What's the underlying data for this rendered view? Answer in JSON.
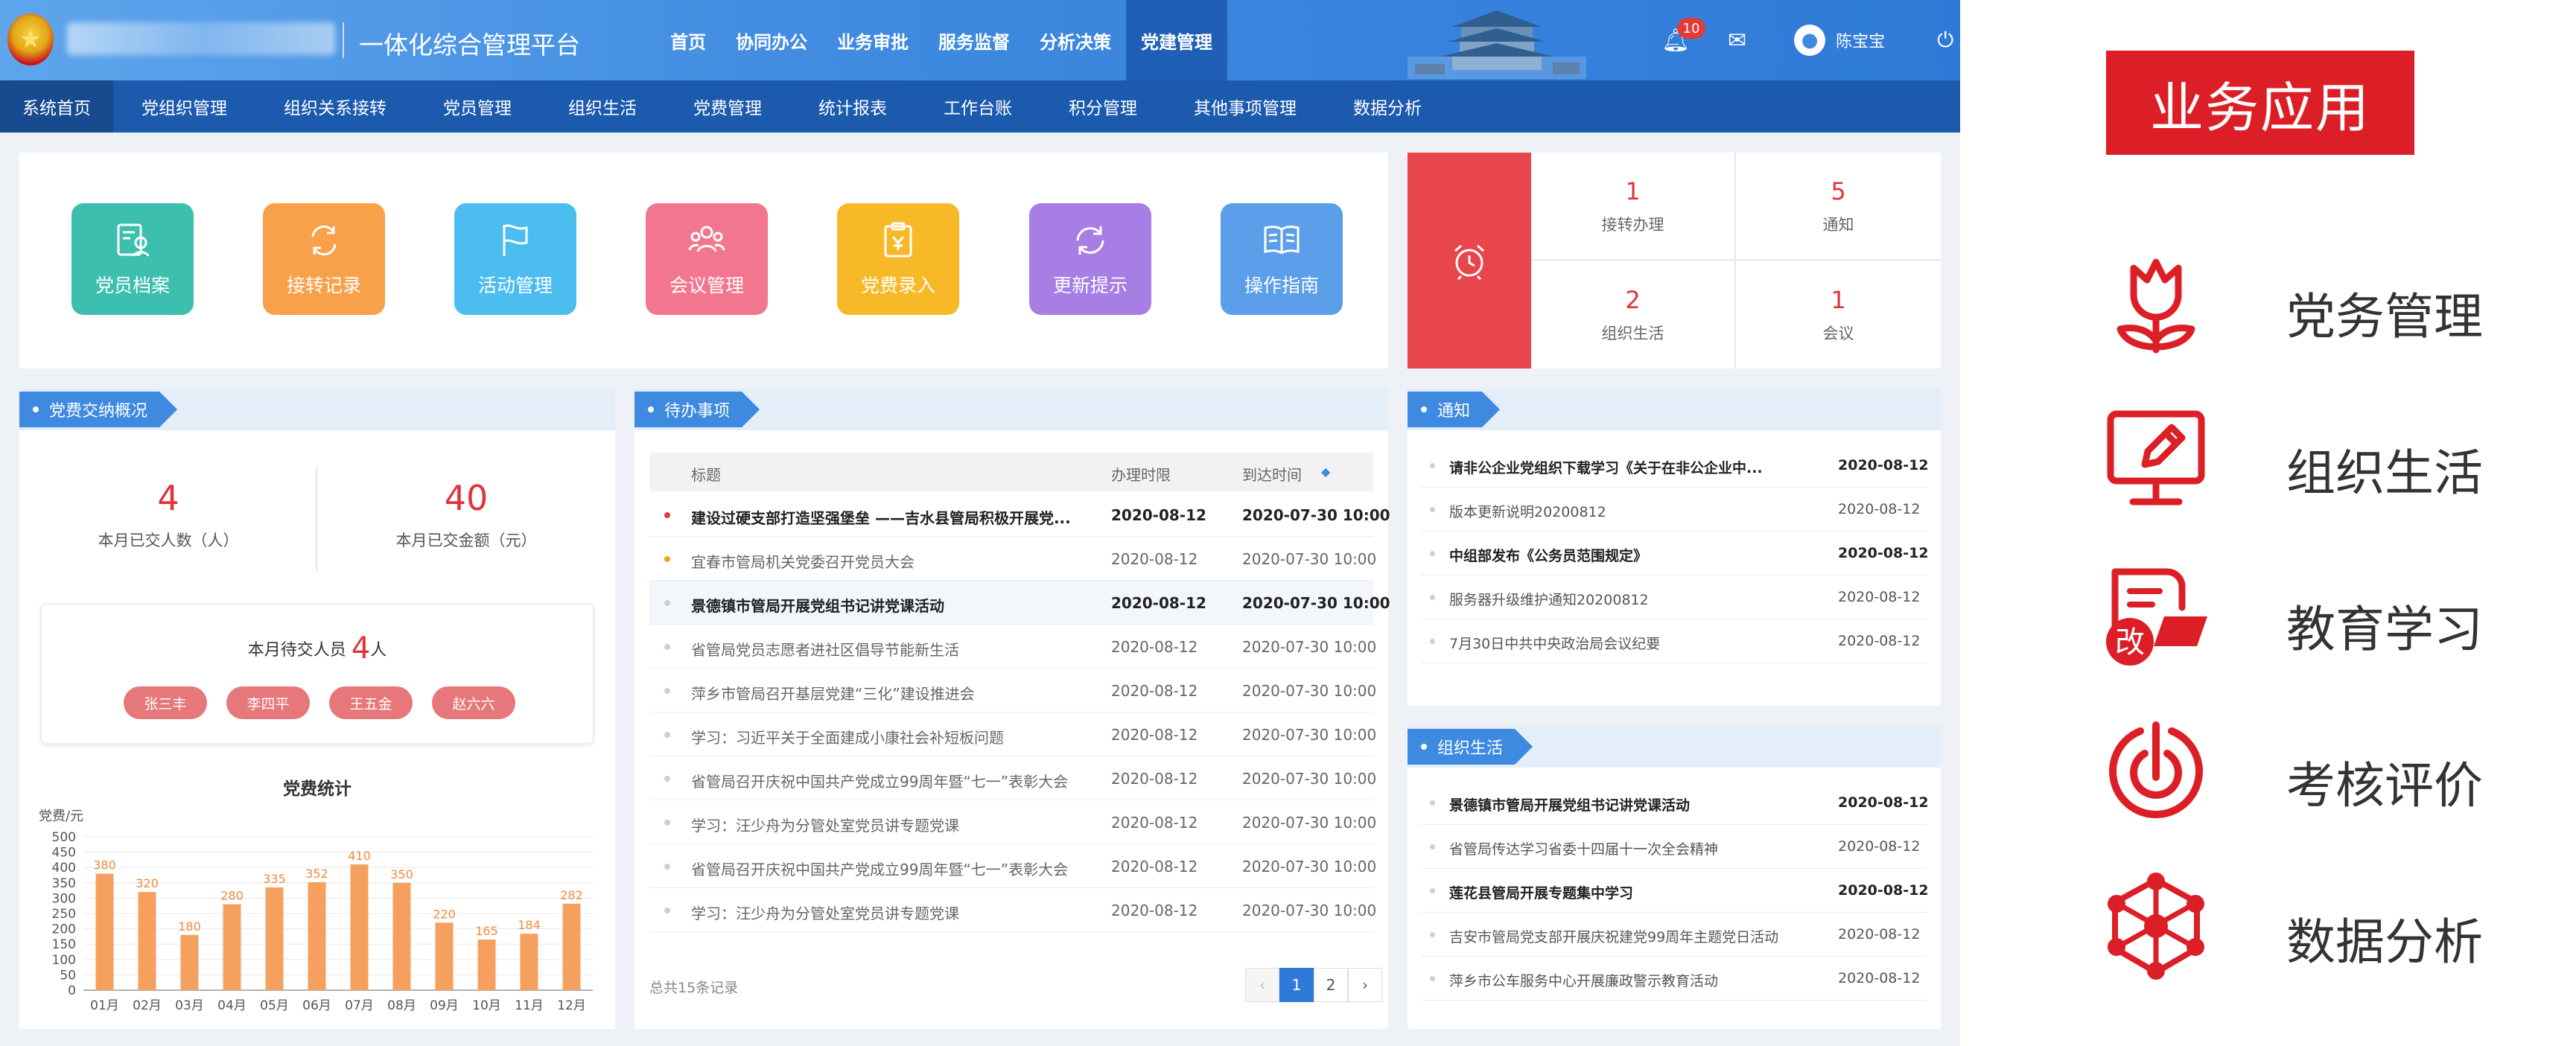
{
  "header": {
    "system_title": "一体化综合管理平台",
    "nav": [
      "首页",
      "协同办公",
      "业务审批",
      "服务监督",
      "分析决策",
      "党建管理"
    ],
    "active_nav": 5,
    "notification_count": "10",
    "user_name": "陈宝宝"
  },
  "subnav": [
    "系统首页",
    "党组织管理",
    "组织关系接转",
    "党员管理",
    "组织生活",
    "党费管理",
    "统计报表",
    "工作台账",
    "积分管理",
    "其他事项管理",
    "数据分析"
  ],
  "quick_tiles": [
    {
      "label": "党员档案",
      "color": "#3cbfae",
      "icon": "member-file-icon"
    },
    {
      "label": "接转记录",
      "color": "#f9a04b",
      "icon": "transfer-icon"
    },
    {
      "label": "活动管理",
      "color": "#4bbdee",
      "icon": "flag-icon"
    },
    {
      "label": "会议管理",
      "color": "#f2768e",
      "icon": "meeting-icon"
    },
    {
      "label": "党费录入",
      "color": "#f7b928",
      "icon": "clipboard-icon"
    },
    {
      "label": "更新提示",
      "color": "#a77ee3",
      "icon": "refresh-icon"
    },
    {
      "label": "操作指南",
      "color": "#5b9ee9",
      "icon": "book-icon"
    }
  ],
  "reminders": [
    {
      "count": "1",
      "label": "接转办理"
    },
    {
      "count": "5",
      "label": "通知"
    },
    {
      "count": "2",
      "label": "组织生活"
    },
    {
      "count": "1",
      "label": "会议"
    }
  ],
  "fee": {
    "section_title": "党费交纳概况",
    "paid_count": "4",
    "paid_count_label": "本月已交人数（人）",
    "paid_amount": "40",
    "paid_amount_label": "本月已交金额（元）",
    "pending_label": "本月待交人员",
    "pending_count": "4",
    "pending_unit": "人",
    "pending_people": [
      "张三丰",
      "李四平",
      "王五金",
      "赵六六"
    ]
  },
  "chart_data": {
    "type": "bar",
    "title": "党费统计",
    "ylabel": "党费/元",
    "categories": [
      "01月",
      "02月",
      "03月",
      "04月",
      "05月",
      "06月",
      "07月",
      "08月",
      "09月",
      "10月",
      "11月",
      "12月"
    ],
    "values": [
      380,
      320,
      180,
      280,
      335,
      352,
      410,
      350,
      220,
      165,
      184,
      282
    ],
    "ylim": [
      0,
      500
    ],
    "yticks": [
      0,
      50,
      100,
      150,
      200,
      250,
      300,
      350,
      400,
      450,
      500
    ],
    "bar_color": "#f5a05f",
    "grid": true
  },
  "todo": {
    "section_title": "待办事项",
    "columns": [
      "标题",
      "办理时限",
      "到达时间"
    ],
    "rows": [
      {
        "title": "建设过硬支部打造坚强堡垒 ——吉水县管局积极开展党...",
        "deadline": "2020-08-12",
        "arrival": "2020-07-30 10:00",
        "bold": true,
        "dot": "#e53935"
      },
      {
        "title": "宜春市管局机关党委召开党员大会",
        "deadline": "2020-08-12",
        "arrival": "2020-07-30 10:00",
        "bold": false,
        "dot": "#f7a21b"
      },
      {
        "title": "景德镇市管局开展党组书记讲党课活动",
        "deadline": "2020-08-12",
        "arrival": "2020-07-30 10:00",
        "bold": true,
        "dot": ""
      },
      {
        "title": "省管局党员志愿者进社区倡导节能新生活",
        "deadline": "2020-08-12",
        "arrival": "2020-07-30 10:00",
        "bold": false,
        "dot": ""
      },
      {
        "title": "萍乡市管局召开基层党建“三化”建设推进会",
        "deadline": "2020-08-12",
        "arrival": "2020-07-30 10:00",
        "bold": false,
        "dot": ""
      },
      {
        "title": "学习：习近平关于全面建成小康社会补短板问题",
        "deadline": "2020-08-12",
        "arrival": "2020-07-30 10:00",
        "bold": false,
        "dot": ""
      },
      {
        "title": "省管局召开庆祝中国共产党成立99周年暨“七一”表彰大会",
        "deadline": "2020-08-12",
        "arrival": "2020-07-30 10:00",
        "bold": false,
        "dot": ""
      },
      {
        "title": "学习：汪少舟为分管处室党员讲专题党课",
        "deadline": "2020-08-12",
        "arrival": "2020-07-30 10:00",
        "bold": false,
        "dot": ""
      },
      {
        "title": "省管局召开庆祝中国共产党成立99周年暨“七一”表彰大会",
        "deadline": "2020-08-12",
        "arrival": "2020-07-30 10:00",
        "bold": false,
        "dot": ""
      },
      {
        "title": "学习：汪少舟为分管处室党员讲专题党课",
        "deadline": "2020-08-12",
        "arrival": "2020-07-30 10:00",
        "bold": false,
        "dot": ""
      }
    ],
    "total_label": "总共15条记录",
    "pages": [
      "1",
      "2"
    ],
    "current_page": "1"
  },
  "notice": {
    "section_title": "通知",
    "rows": [
      {
        "title": "请非公企业党组织下载学习《关于在非公企业中...",
        "date": "2020-08-12",
        "bold": true
      },
      {
        "title": "版本更新说明20200812",
        "date": "2020-08-12",
        "bold": false
      },
      {
        "title": "中组部发布《公务员范围规定》",
        "date": "2020-08-12",
        "bold": true
      },
      {
        "title": "服务器升级维护通知20200812",
        "date": "2020-08-12",
        "bold": false
      },
      {
        "title": "7月30日中共中央政治局会议纪要",
        "date": "2020-08-12",
        "bold": false
      }
    ]
  },
  "org_life": {
    "section_title": "组织生活",
    "rows": [
      {
        "title": "景德镇市管局开展党组书记讲党课活动",
        "date": "2020-08-12",
        "bold": true
      },
      {
        "title": "省管局传达学习省委十四届十一次全会精神",
        "date": "2020-08-12",
        "bold": false
      },
      {
        "title": "莲花县管局开展专题集中学习",
        "date": "2020-08-12",
        "bold": true
      },
      {
        "title": "吉安市管局党支部开展庆祝建党99周年主题党日活动",
        "date": "2020-08-12",
        "bold": false
      },
      {
        "title": "萍乡市公车服务中心开展廉政警示教育活动",
        "date": "2020-08-12",
        "bold": false
      }
    ]
  },
  "right_panel": {
    "title": "业务应用",
    "accent": "#dc1f26",
    "items": [
      {
        "label": "党务管理",
        "icon": "tulip-icon"
      },
      {
        "label": "组织生活",
        "icon": "monitor-pen-icon"
      },
      {
        "label": "教育学习",
        "icon": "book-edit-icon"
      },
      {
        "label": "考核评价",
        "icon": "target-icon"
      },
      {
        "label": "数据分析",
        "icon": "network-icon"
      }
    ]
  }
}
